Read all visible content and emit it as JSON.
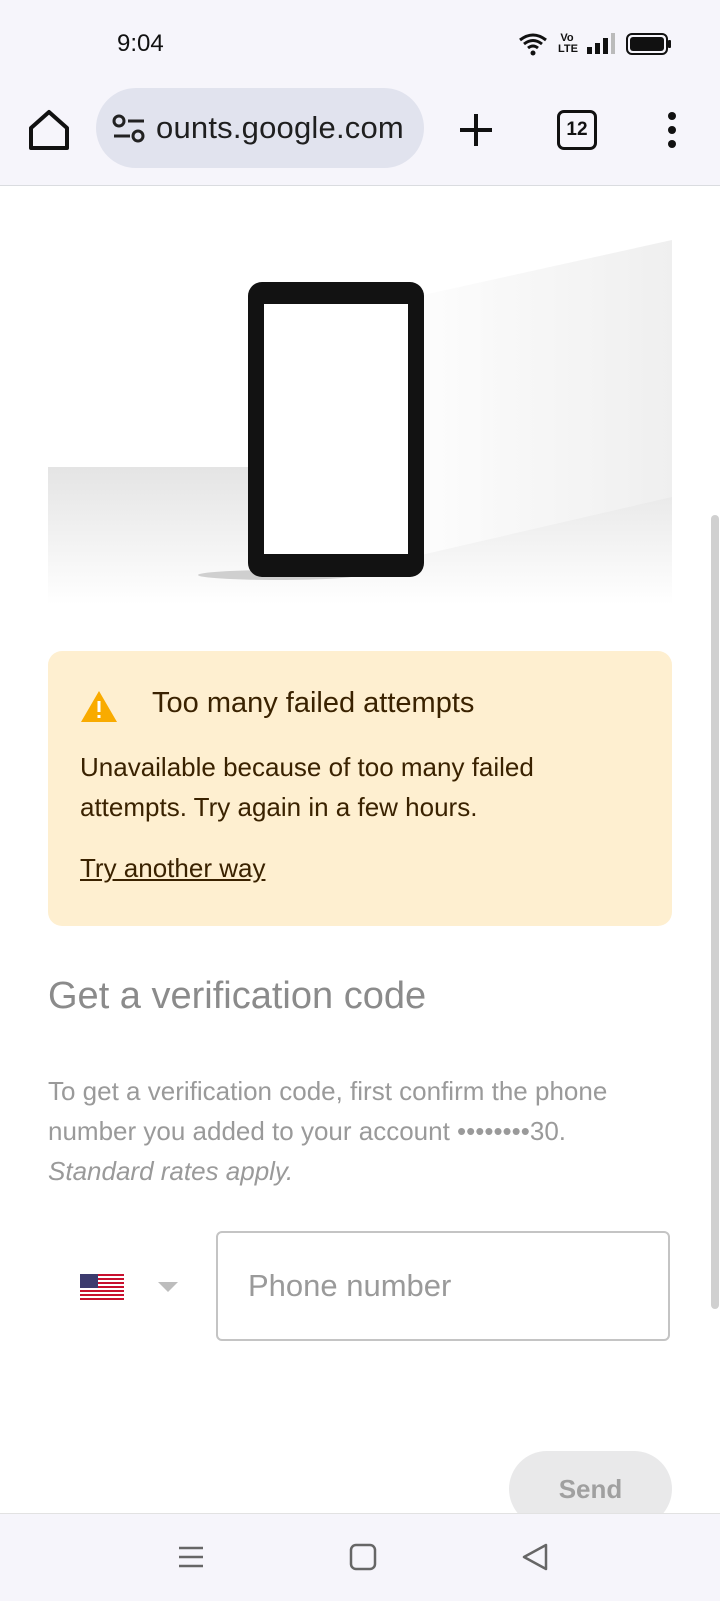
{
  "status_bar": {
    "time": "9:04",
    "network_label": "Vo LTE"
  },
  "browser": {
    "url": "ounts.google.com",
    "tab_count": "12",
    "icons": [
      "home-icon",
      "site-settings-icon",
      "plus-icon",
      "tab-switcher-icon",
      "more-vert-icon"
    ]
  },
  "alert": {
    "title": "Too many failed attempts",
    "body": "Unavailable because of too many failed attempts. Try again in a few hours.",
    "link": "Try another way",
    "colors": {
      "background": "#feefd0",
      "icon": "#f9ab00",
      "text": "#3a2200"
    }
  },
  "verification": {
    "heading": "Get a verification code",
    "description": "To get a verification code, first confirm the phone number you added to your account ••••••••30.",
    "description_italic": "Standard rates apply.",
    "country_flag": "us-flag-icon",
    "phone_placeholder": "Phone number",
    "phone_value": "",
    "send_label": "Send"
  },
  "nav_bar": {
    "icons": [
      "recents-icon",
      "home-nav-icon",
      "back-icon"
    ]
  }
}
